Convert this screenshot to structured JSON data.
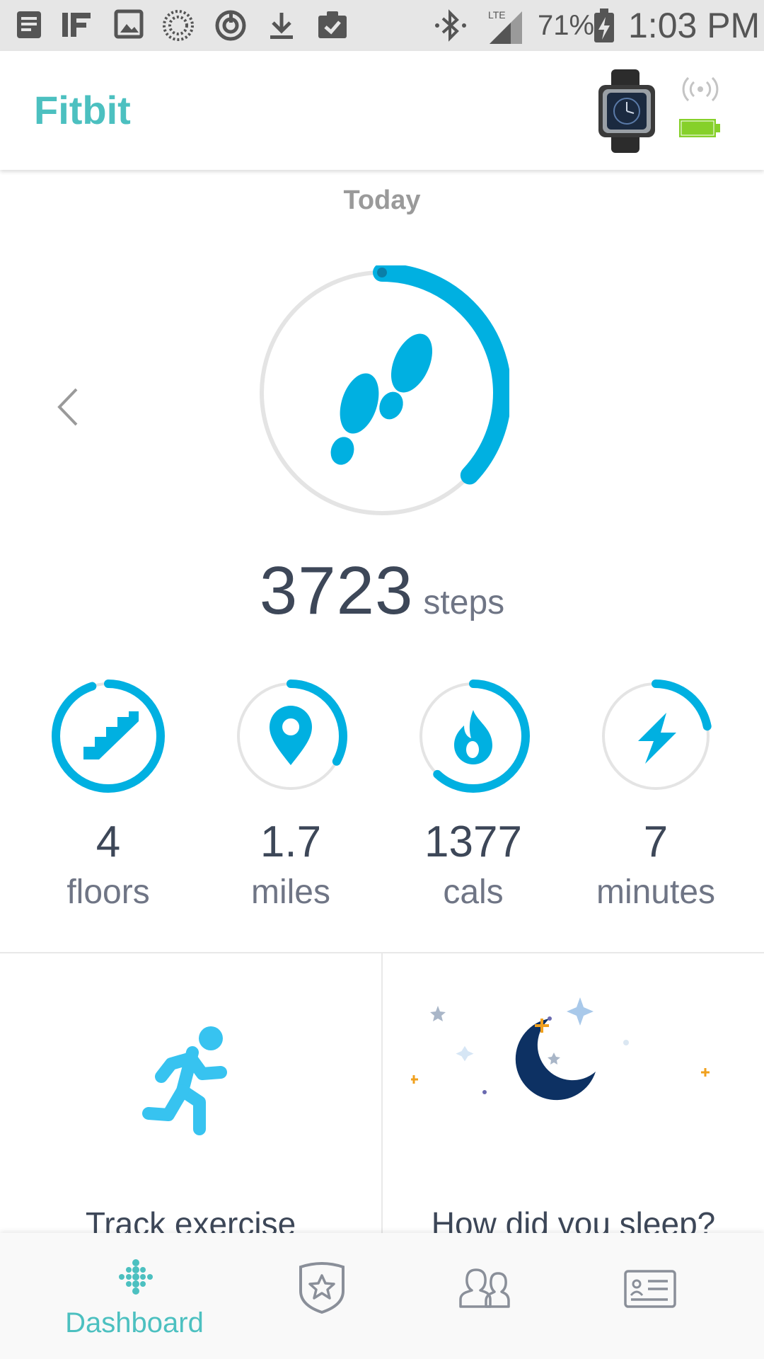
{
  "status_bar": {
    "battery_percent": "71%",
    "time": "1:03 PM",
    "network": "LTE",
    "icons": [
      "notes-icon",
      "ifttt-icon",
      "image-icon",
      "sync-dots-icon",
      "power-sync-icon",
      "download-icon",
      "clipboard-check-icon",
      "bluetooth-icon",
      "signal-icon",
      "battery-charging-icon"
    ]
  },
  "app_bar": {
    "title": "Fitbit",
    "device_icon": "smartwatch-icon",
    "sync_icon": "broadcast-icon",
    "battery_icon": "battery-full-icon",
    "battery_color": "#86d02a"
  },
  "dashboard": {
    "date_label": "Today",
    "steps": {
      "value": "3723",
      "unit": "steps",
      "progress": 0.37,
      "icon": "footprints-icon"
    },
    "stats": [
      {
        "id": "floors",
        "value": "4",
        "unit": "floors",
        "progress": 0.95,
        "icon": "stairs-icon"
      },
      {
        "id": "miles",
        "value": "1.7",
        "unit": "miles",
        "progress": 0.33,
        "icon": "location-pin-icon"
      },
      {
        "id": "cals",
        "value": "1377",
        "unit": "cals",
        "progress": 0.62,
        "icon": "flame-icon"
      },
      {
        "id": "minutes",
        "value": "7",
        "unit": "minutes",
        "progress": 0.22,
        "icon": "lightning-icon"
      }
    ],
    "tiles": [
      {
        "id": "exercise",
        "label": "Track exercise",
        "icon": "running-person-icon"
      },
      {
        "id": "sleep",
        "label": "How did you sleep?",
        "icon": "moon-stars-icon"
      }
    ]
  },
  "bottom_nav": {
    "items": [
      {
        "id": "dashboard",
        "label": "Dashboard",
        "icon": "fitbit-dots-icon",
        "active": true
      },
      {
        "id": "challenges",
        "label": "",
        "icon": "star-badge-icon",
        "active": false
      },
      {
        "id": "friends",
        "label": "",
        "icon": "friends-icon",
        "active": false
      },
      {
        "id": "account",
        "label": "",
        "icon": "profile-card-icon",
        "active": false
      }
    ]
  },
  "colors": {
    "accent": "#00b0e1",
    "teal": "#4cc0c0",
    "track": "#e4e4e4",
    "text": "#3d4758",
    "moon": "#0d3163",
    "star_orange": "#f0a01e",
    "star_blue": "#a9c9ea"
  }
}
